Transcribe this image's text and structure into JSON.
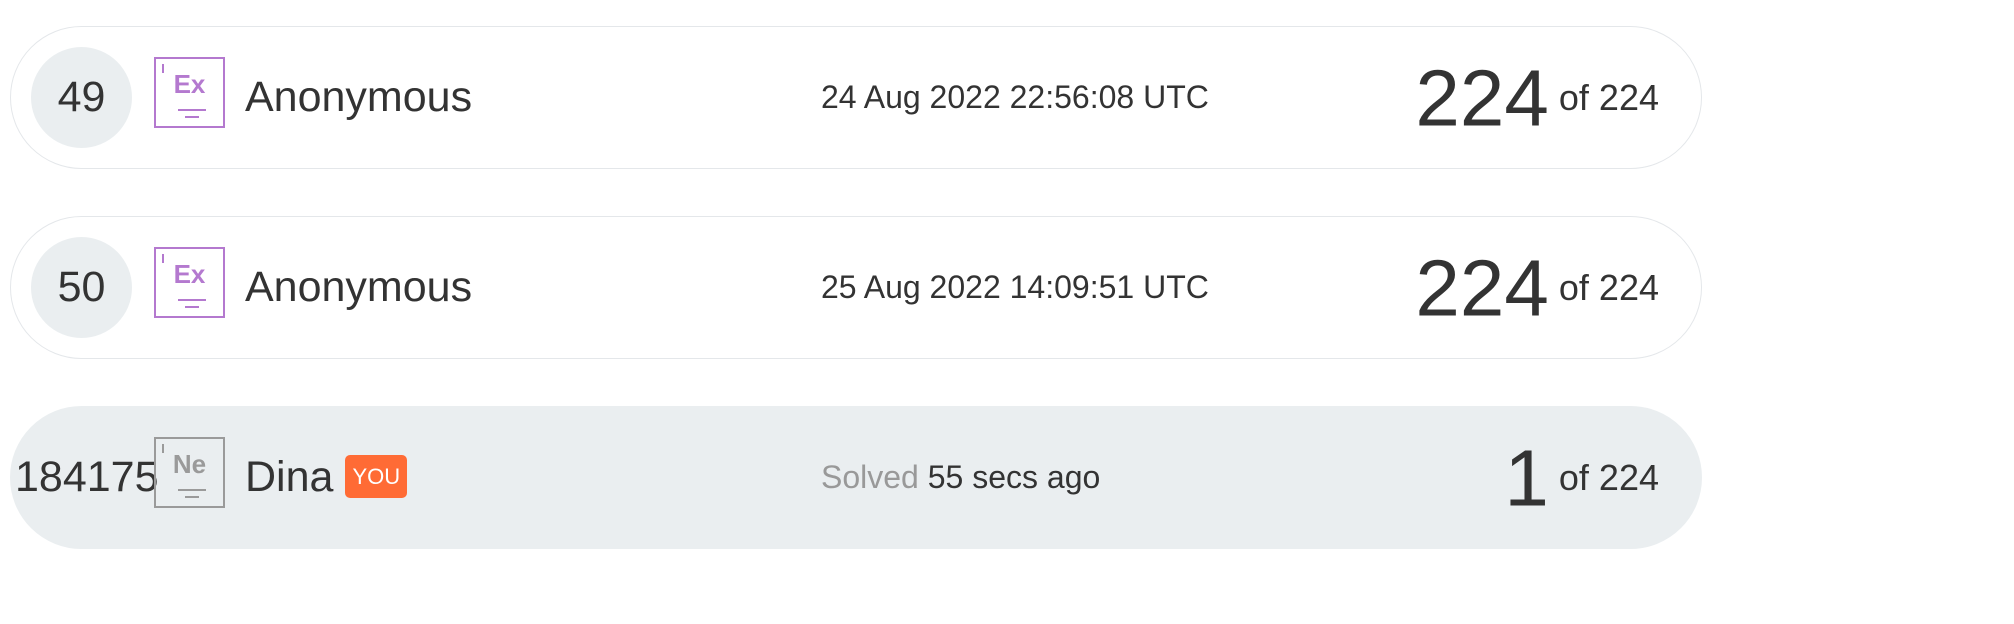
{
  "rows": [
    {
      "rank": "49",
      "level_symbol": "Ex",
      "level_color": "#b479cf",
      "name": "Anonymous",
      "date": "24 Aug 2022 22:56:08 UTC",
      "score": "224",
      "total": "of 224"
    },
    {
      "rank": "50",
      "level_symbol": "Ex",
      "level_color": "#b479cf",
      "name": "Anonymous",
      "date": "25 Aug 2022 14:09:51 UTC",
      "score": "224",
      "total": "of 224"
    },
    {
      "rank": "184175",
      "level_symbol": "Ne",
      "level_color": "#9a9a9a",
      "name": "Dina",
      "badge": "YOU",
      "badge_color": "#ff6b35",
      "solved_label": "Solved",
      "date": "55 secs ago",
      "score": "1",
      "total": "of 224"
    }
  ]
}
